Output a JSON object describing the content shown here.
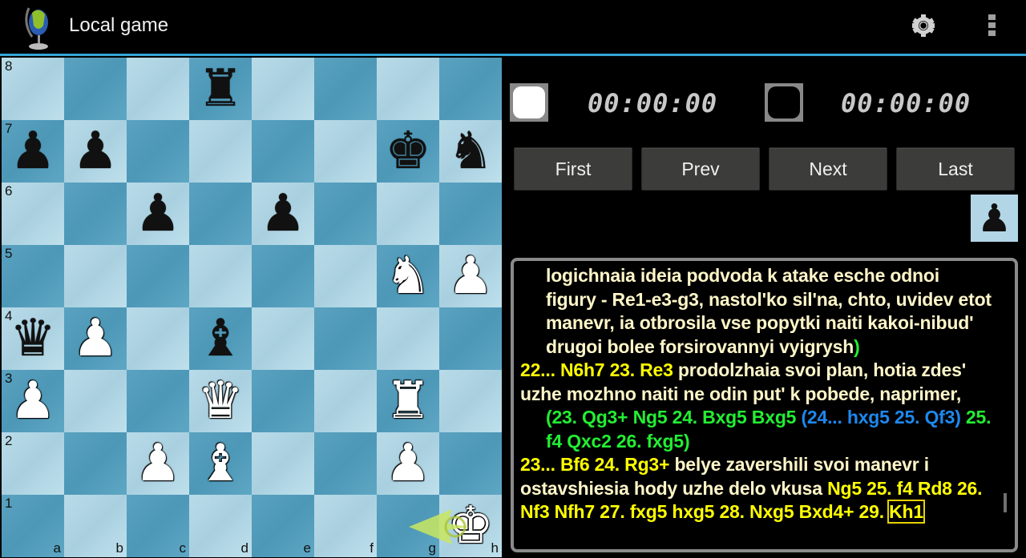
{
  "actionbar": {
    "title": "Local game",
    "app_icon": "chess-globe-icon",
    "settings_icon": "gear-icon",
    "menu_icon": "overflow-menu-icon",
    "accent_color": "#33a5d8"
  },
  "board": {
    "orientation": "white",
    "rank_labels": [
      "8",
      "7",
      "6",
      "5",
      "4",
      "3",
      "2",
      "1"
    ],
    "file_labels": [
      "a",
      "b",
      "c",
      "d",
      "e",
      "f",
      "g",
      "h"
    ],
    "pieces": [
      {
        "square": "d8",
        "color": "b",
        "type": "rook",
        "glyph": "♜"
      },
      {
        "square": "a7",
        "color": "b",
        "type": "pawn",
        "glyph": "♟"
      },
      {
        "square": "b7",
        "color": "b",
        "type": "pawn",
        "glyph": "♟"
      },
      {
        "square": "g7",
        "color": "b",
        "type": "king",
        "glyph": "♚"
      },
      {
        "square": "h7",
        "color": "b",
        "type": "knight",
        "glyph": "♞"
      },
      {
        "square": "c6",
        "color": "b",
        "type": "pawn",
        "glyph": "♟"
      },
      {
        "square": "e6",
        "color": "b",
        "type": "pawn",
        "glyph": "♟"
      },
      {
        "square": "g5",
        "color": "w",
        "type": "knight",
        "glyph": "♞"
      },
      {
        "square": "h5",
        "color": "w",
        "type": "pawn",
        "glyph": "♟"
      },
      {
        "square": "a4",
        "color": "b",
        "type": "queen",
        "glyph": "♛"
      },
      {
        "square": "b4",
        "color": "w",
        "type": "pawn",
        "glyph": "♟"
      },
      {
        "square": "d4",
        "color": "b",
        "type": "bishop",
        "glyph": "♝"
      },
      {
        "square": "a3",
        "color": "w",
        "type": "pawn",
        "glyph": "♟"
      },
      {
        "square": "d3",
        "color": "w",
        "type": "queen",
        "glyph": "♛"
      },
      {
        "square": "g3",
        "color": "w",
        "type": "rook",
        "glyph": "♜"
      },
      {
        "square": "c2",
        "color": "w",
        "type": "pawn",
        "glyph": "♟"
      },
      {
        "square": "d2",
        "color": "w",
        "type": "bishop",
        "glyph": "♝"
      },
      {
        "square": "g2",
        "color": "w",
        "type": "pawn",
        "glyph": "♟"
      },
      {
        "square": "h1",
        "color": "w",
        "type": "king",
        "glyph": "♚"
      }
    ],
    "last_move": {
      "from": "g1",
      "to": "h1"
    }
  },
  "clocks": {
    "white_time": "00:00:00",
    "black_time": "00:00:00",
    "white_indicator": "white-side-icon",
    "black_indicator": "black-side-icon"
  },
  "navigation": {
    "first": "First",
    "prev": "Prev",
    "next": "Next",
    "last": "Last"
  },
  "turn_indicator": {
    "glyph": "♟",
    "side": "black"
  },
  "movelist": {
    "p1": "logichnaia ideia podvoda k atake esche odnoi figury - Re1-e3-g3, nastol'ko sil'na, chto, uvidev etot manevr, ia otbrosila vse popytki naiti kakoi-nibud' drugoi bolee forsirovannyi vyigrysh",
    "p1_close": ")",
    "p2_moves": "22... N6h7 23. Re3",
    "p2_comment": " prodolzhaia svoi plan, hotia zdes' uzhe mozhno naiti ne odin put' k pobede, naprimer,",
    "p3_var1": "(23. Qg3+ Ng5 24. Bxg5 Bxg5 ",
    "p3_var2": "(24... hxg5 25. Qf3)",
    "p3_var1_end": " 25. f4 Qxc2 26. fxg5)",
    "p4_moves": "23... Bf6 24. Rg3+",
    "p4_comment": " belye zavershili svoi manevr i ostavshiesia hody uzhe delo vkusa ",
    "p4_moves2": "Ng5 25. f4 Rd8 26. Nf3 Nfh7 27. fxg5 hxg5 28. Nxg5 Bxd4+ 29. ",
    "current_move": "Kh1"
  }
}
